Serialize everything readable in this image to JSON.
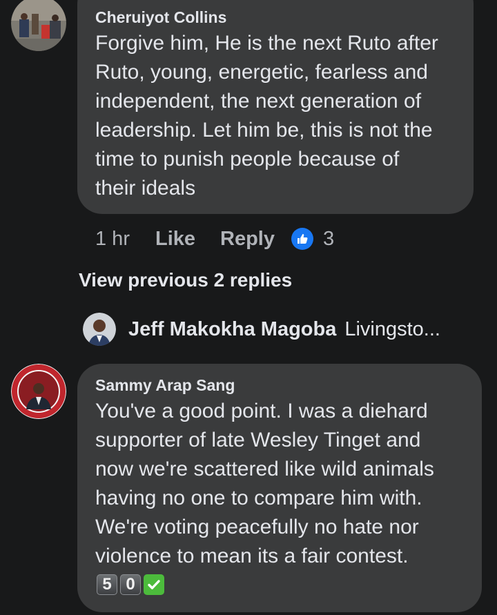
{
  "comments": [
    {
      "author": "Cheruiyot Collins",
      "text": "Forgive him, He is the next Ruto after\nRuto, young, energetic, fearless and\nindependent, the next generation of\nleadership. Let him be, this is not the\ntime to punish people because of\ntheir ideals",
      "time": "1 hr",
      "like_label": "Like",
      "reply_label": "Reply",
      "reactions_count": "3"
    },
    {
      "author": "Sammy Arap Sang",
      "text": "You've a good point. I was a diehard\nsupporter of late Wesley Tinget and\nnow we're scattered like wild  animals\nhaving no one to compare him with.\nWe're voting peacefully no hate nor\nviolence to mean its a fair contest.",
      "emoji_keycaps": [
        "5",
        "0"
      ],
      "emoji_check": "check-mark-button-icon"
    }
  ],
  "view_previous_replies": "View previous 2 replies",
  "reply_preview": {
    "name": "Jeff Makokha Magoba",
    "snippet": "Livingsto..."
  },
  "colors": {
    "background": "#18191a",
    "bubble": "#3a3b3c",
    "text": "#e4e6eb",
    "secondary_text": "#b0b3b8",
    "like_blue": "#1877f2"
  }
}
